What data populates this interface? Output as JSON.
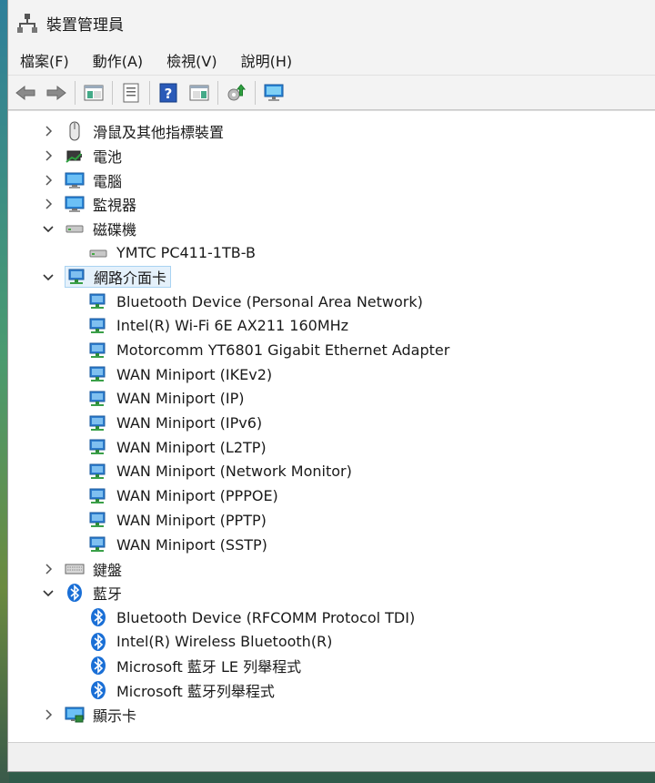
{
  "window": {
    "title": "裝置管理員"
  },
  "menu": {
    "file": "檔案(F)",
    "action": "動作(A)",
    "view": "檢視(V)",
    "help": "說明(H)"
  },
  "tree": {
    "mice": "滑鼠及其他指標裝置",
    "batteries": "電池",
    "computer": "電腦",
    "monitors": "監視器",
    "disk_drives": {
      "label": "磁碟機",
      "devices": [
        "YMTC PC411-1TB-B"
      ]
    },
    "network_adapters": {
      "label": "網路介面卡",
      "devices": [
        "Bluetooth Device (Personal Area Network)",
        "Intel(R) Wi-Fi 6E AX211 160MHz",
        "Motorcomm YT6801 Gigabit Ethernet Adapter",
        "WAN Miniport (IKEv2)",
        "WAN Miniport (IP)",
        "WAN Miniport (IPv6)",
        "WAN Miniport (L2TP)",
        "WAN Miniport (Network Monitor)",
        "WAN Miniport (PPPOE)",
        "WAN Miniport (PPTP)",
        "WAN Miniport (SSTP)"
      ]
    },
    "keyboards": "鍵盤",
    "bluetooth": {
      "label": "藍牙",
      "devices": [
        "Bluetooth Device (RFCOMM Protocol TDI)",
        "Intel(R) Wireless Bluetooth(R)",
        "Microsoft 藍牙 LE 列舉程式",
        "Microsoft 藍牙列舉程式"
      ]
    },
    "display_adapters": "顯示卡"
  }
}
